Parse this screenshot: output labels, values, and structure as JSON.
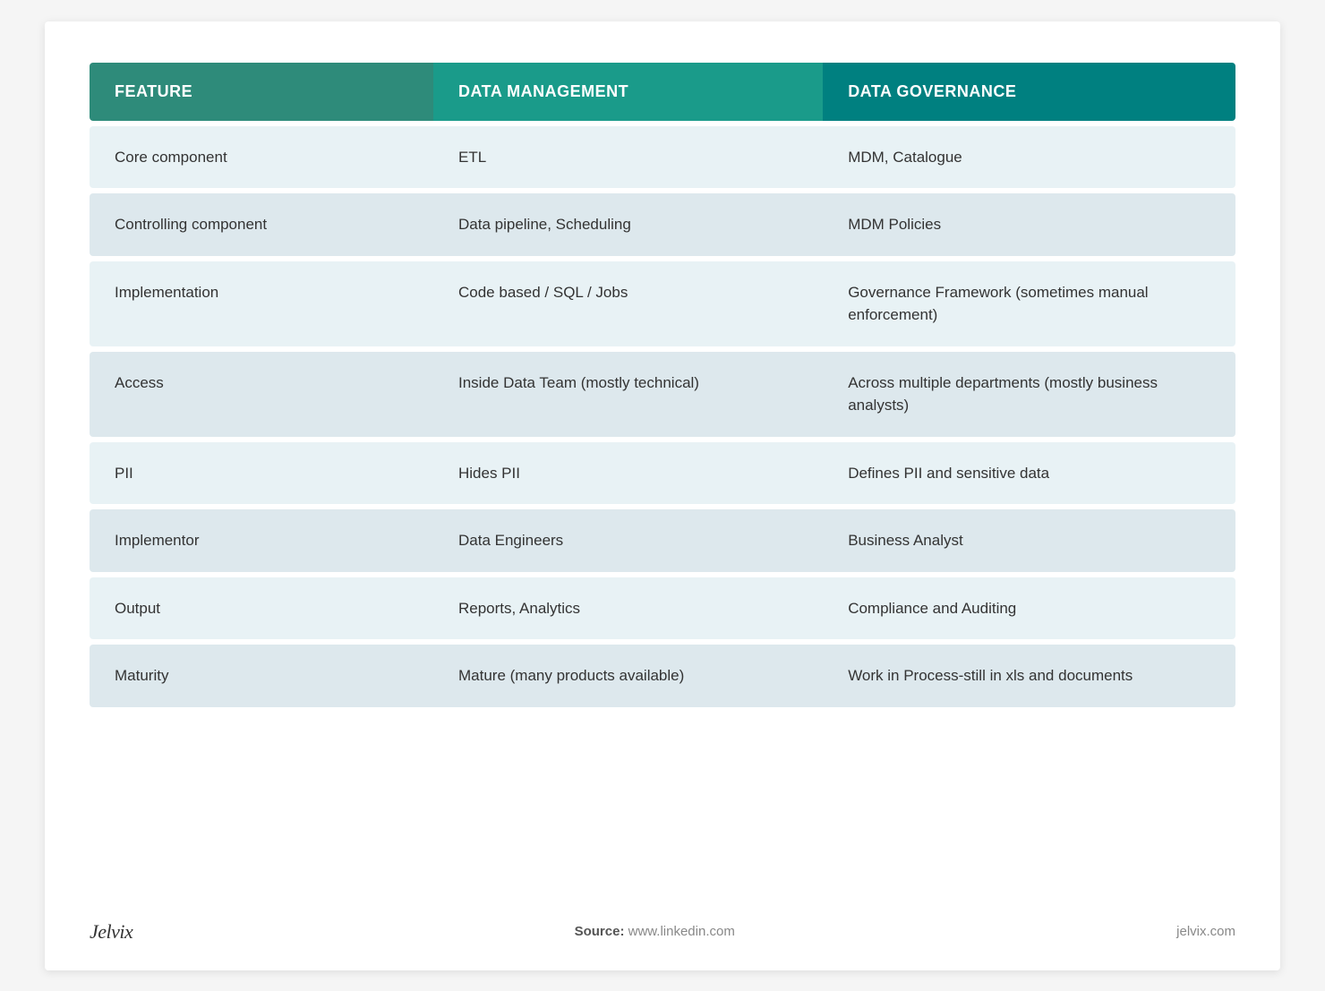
{
  "header": {
    "col1": "FEATURE",
    "col2": "DATA MANAGEMENT",
    "col3": "DATA GOVERNANCE"
  },
  "rows": [
    {
      "feature": "Core component",
      "data_management": "ETL",
      "data_governance": "MDM, Catalogue"
    },
    {
      "feature": "Controlling component",
      "data_management": "Data pipeline, Scheduling",
      "data_governance": "MDM Policies"
    },
    {
      "feature": "Implementation",
      "data_management": "Code based / SQL / Jobs",
      "data_governance": "Governance Framework (sometimes manual enforcement)"
    },
    {
      "feature": "Access",
      "data_management": "Inside Data Team (mostly technical)",
      "data_governance": "Across multiple departments (mostly business analysts)"
    },
    {
      "feature": "PII",
      "data_management": "Hides PII",
      "data_governance": "Defines PII and sensitive data"
    },
    {
      "feature": "Implementor",
      "data_management": "Data Engineers",
      "data_governance": "Business Analyst"
    },
    {
      "feature": "Output",
      "data_management": "Reports, Analytics",
      "data_governance": "Compliance and Auditing"
    },
    {
      "feature": "Maturity",
      "data_management": "Mature (many products available)",
      "data_governance": "Work in Process-still in xls and documents"
    }
  ],
  "footer": {
    "logo": "Jelvix",
    "source_label": "Source:",
    "source_url": "www.linkedin.com",
    "site_url": "jelvix.com"
  }
}
